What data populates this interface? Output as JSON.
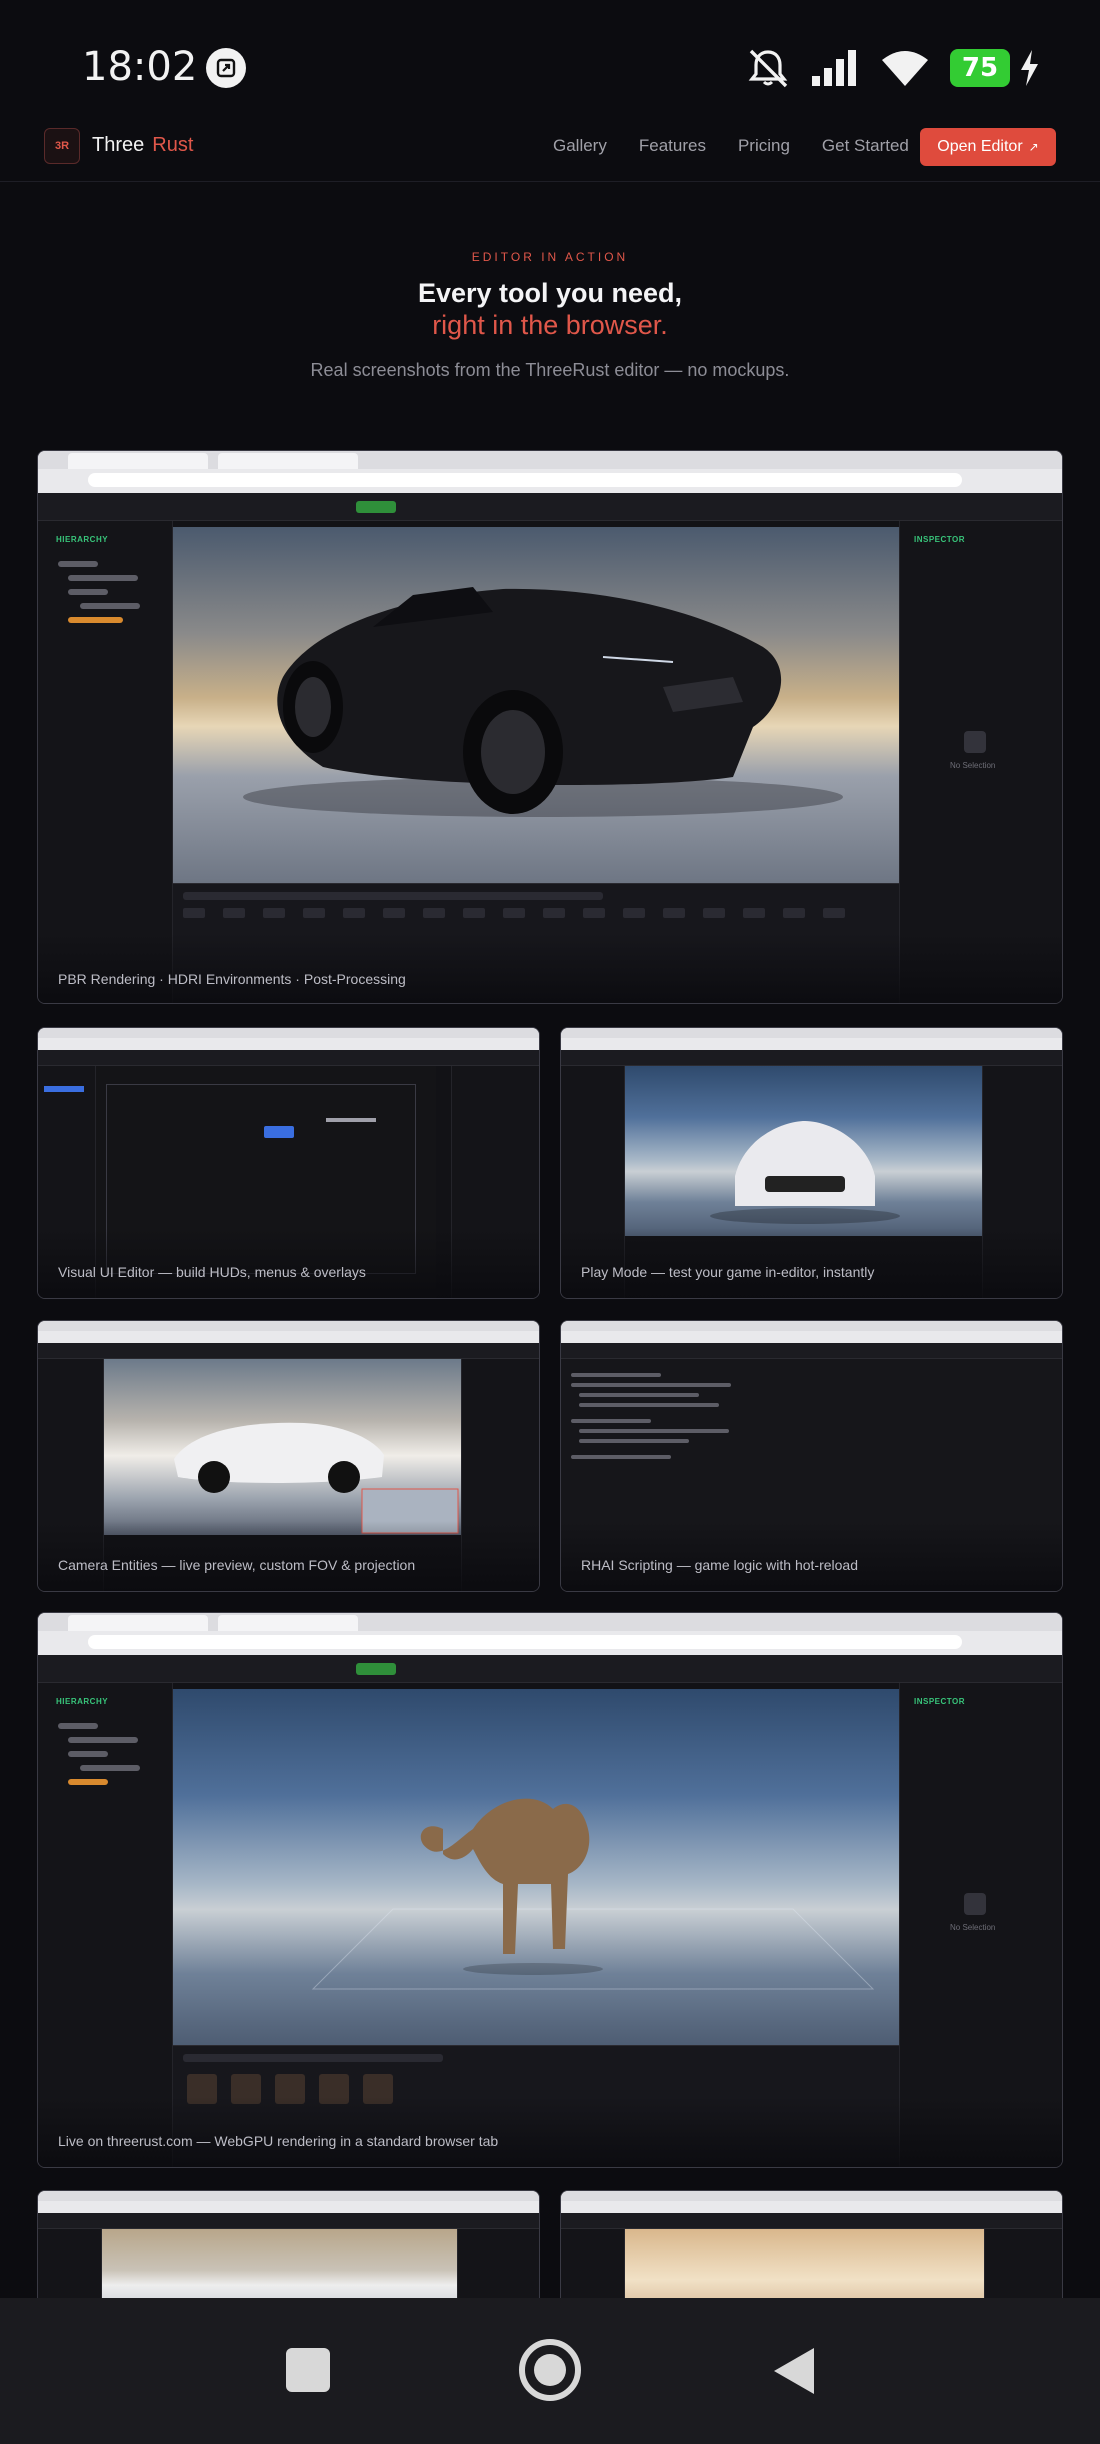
{
  "status_bar": {
    "time": "18:02",
    "battery": "75",
    "icons": [
      "screen-capture-icon",
      "mute-icon",
      "signal-icon",
      "wifi-icon",
      "battery-icon",
      "charging-icon"
    ]
  },
  "nav": {
    "brand_first": "Three",
    "brand_second": "Rust",
    "links": [
      "Gallery",
      "Features",
      "Pricing",
      "Get Started"
    ],
    "cta": "Open Editor",
    "cta_icon": "external-link-icon"
  },
  "hero": {
    "eyebrow": "EDITOR IN ACTION",
    "title_line1": "Every tool you need,",
    "title_line2": "right in the browser.",
    "subtitle": "Real screenshots from the ThreeRust editor — no mockups."
  },
  "gallery": {
    "captions": [
      "PBR Rendering · HDRI Environments · Post-Processing",
      "Visual UI Editor — build HUDs, menus & overlays",
      "Play Mode — test your game in-editor, instantly",
      "Camera Entities — live preview, custom FOV & projection",
      "RHAI Scripting — game logic with hot-reload",
      "Live on threerust.com — WebGPU rendering in a standard browser tab"
    ],
    "editor_labels": {
      "hierarchy": "HIERARCHY",
      "inspector": "INSPECTOR",
      "no_selection": "No Selection"
    }
  },
  "colors": {
    "accent": "#e0574a",
    "background": "#0c0c10",
    "panel_green": "#38c47a"
  },
  "android_nav": [
    "recents-button",
    "home-button",
    "back-button"
  ]
}
